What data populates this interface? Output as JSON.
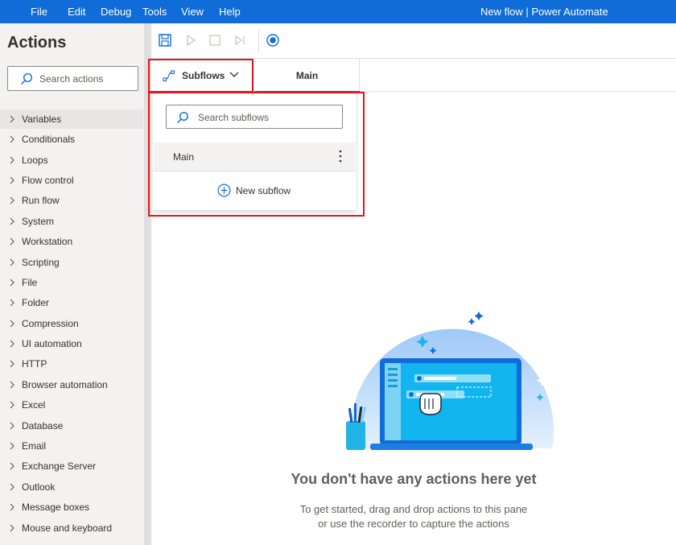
{
  "menu": {
    "items": [
      "File",
      "Edit",
      "Debug",
      "Tools",
      "View",
      "Help"
    ],
    "window_title": "New flow | Power Automate"
  },
  "actions_pane": {
    "title": "Actions",
    "search_placeholder": "Search actions",
    "categories": [
      "Variables",
      "Conditionals",
      "Loops",
      "Flow control",
      "Run flow",
      "System",
      "Workstation",
      "Scripting",
      "File",
      "Folder",
      "Compression",
      "UI automation",
      "HTTP",
      "Browser automation",
      "Excel",
      "Database",
      "Email",
      "Exchange Server",
      "Outlook",
      "Message boxes",
      "Mouse and keyboard"
    ]
  },
  "toolbar": {
    "icons": [
      "save-icon",
      "run-icon",
      "stop-icon",
      "run-next-action-icon",
      "recorder-icon"
    ]
  },
  "tabs": {
    "subflows_label": "Subflows",
    "main_label": "Main"
  },
  "subflow_panel": {
    "search_placeholder": "Search subflows",
    "items": [
      "Main"
    ],
    "new_subflow_label": "New subflow"
  },
  "empty_state": {
    "title": "You don't have any actions here yet",
    "line1": "To get started, drag and drop actions to this pane",
    "line2": "or use the recorder to capture the actions"
  },
  "colors": {
    "accent": "#0f6cd8",
    "highlight": "#e3141c",
    "pane_bg": "#f3f2f1"
  }
}
